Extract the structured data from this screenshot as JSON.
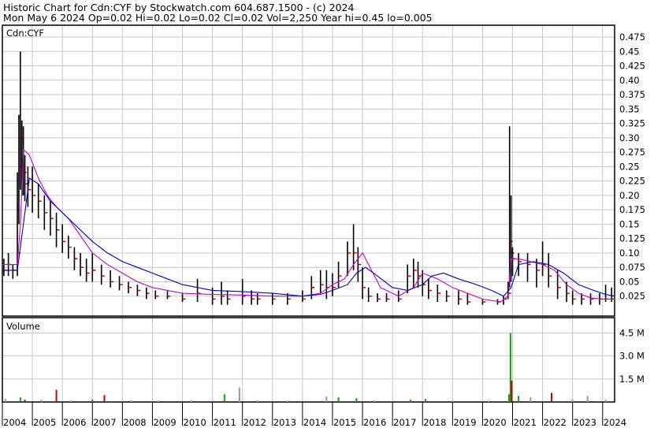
{
  "header": {
    "line1": "Historic Chart for Cdn:CYF  by Stockwatch.com 604.687.1500 - (c) 2024",
    "line2": "Mon May  6 2024   Op=0.02  Hi=0.02  Lo=0.02  Cl=0.02  Vol=2,250  Year hi=0.45  lo=0.005"
  },
  "price_panel": {
    "label": "Cdn:CYF"
  },
  "volume_panel": {
    "label": "Volume"
  },
  "colors": {
    "grid": "#c8c8c8",
    "bar": "#000000",
    "close_tick": "#cc0000",
    "ma_short": "#cc00cc",
    "ma_long": "#0000cc",
    "vol_up": "#00aa00",
    "vol_down": "#cc0000",
    "vol_flat": "#999999"
  },
  "chart_data": [
    {
      "type": "line",
      "title": "",
      "ylim": [
        0,
        0.475
      ],
      "y_ticks": [
        0.025,
        0.05,
        0.075,
        0.1,
        0.125,
        0.15,
        0.175,
        0.2,
        0.225,
        0.25,
        0.275,
        0.3,
        0.325,
        0.35,
        0.375,
        0.4,
        0.425,
        0.45,
        0.475
      ],
      "y_tick_labels": [
        "0.025",
        "0.05",
        "0.075",
        "0.10",
        "0.125",
        "0.15",
        "0.175",
        "0.20",
        "0.225",
        "0.25",
        "0.275",
        "0.30",
        "0.325",
        "0.35",
        "0.375",
        "0.40",
        "0.425",
        "0.45",
        "0.475"
      ],
      "x_tick_labels": [
        "2004",
        "2005",
        "2006",
        "2007",
        "2008",
        "2009",
        "2010",
        "2011",
        "2012",
        "2013",
        "2014",
        "2015",
        "2016",
        "2017",
        "2018",
        "2019",
        "2020",
        "2021",
        "2022",
        "2023",
        "2024"
      ],
      "x_range": [
        2004.0,
        2024.4
      ],
      "series": [
        {
          "style": "high-low-bars",
          "x": [
            2004.05,
            2004.2,
            2004.35,
            2004.5,
            2004.55,
            2004.6,
            2004.65,
            2004.7,
            2004.75,
            2004.85,
            2005.0,
            2005.2,
            2005.4,
            2005.6,
            2005.8,
            2006.0,
            2006.2,
            2006.4,
            2006.6,
            2006.8,
            2007.0,
            2007.3,
            2007.6,
            2007.9,
            2008.2,
            2008.5,
            2008.8,
            2009.1,
            2009.5,
            2010.0,
            2010.5,
            2011.0,
            2011.3,
            2011.5,
            2012.0,
            2012.3,
            2012.5,
            2013.0,
            2013.5,
            2014.0,
            2014.3,
            2014.6,
            2014.8,
            2015.0,
            2015.2,
            2015.5,
            2015.7,
            2015.85,
            2016.0,
            2016.2,
            2016.5,
            2016.8,
            2017.2,
            2017.5,
            2017.7,
            2017.85,
            2018.0,
            2018.2,
            2018.5,
            2018.8,
            2019.2,
            2019.5,
            2020.0,
            2020.5,
            2020.7,
            2020.85,
            2020.9,
            2020.95,
            2021.0,
            2021.2,
            2021.5,
            2021.8,
            2022.0,
            2022.2,
            2022.5,
            2022.8,
            2023.0,
            2023.3,
            2023.6,
            2023.9,
            2024.1,
            2024.3
          ],
          "high": [
            0.09,
            0.1,
            0.08,
            0.24,
            0.34,
            0.45,
            0.33,
            0.32,
            0.27,
            0.25,
            0.25,
            0.22,
            0.2,
            0.19,
            0.17,
            0.15,
            0.13,
            0.11,
            0.1,
            0.09,
            0.1,
            0.08,
            0.07,
            0.06,
            0.05,
            0.045,
            0.04,
            0.035,
            0.035,
            0.03,
            0.055,
            0.04,
            0.05,
            0.035,
            0.055,
            0.035,
            0.03,
            0.03,
            0.03,
            0.035,
            0.06,
            0.07,
            0.07,
            0.065,
            0.085,
            0.12,
            0.15,
            0.11,
            0.075,
            0.04,
            0.03,
            0.03,
            0.035,
            0.08,
            0.09,
            0.085,
            0.07,
            0.055,
            0.045,
            0.035,
            0.035,
            0.03,
            0.02,
            0.02,
            0.025,
            0.05,
            0.32,
            0.2,
            0.11,
            0.1,
            0.1,
            0.09,
            0.12,
            0.1,
            0.07,
            0.05,
            0.035,
            0.03,
            0.03,
            0.03,
            0.045,
            0.04
          ],
          "low": [
            0.06,
            0.06,
            0.055,
            0.06,
            0.15,
            0.21,
            0.2,
            0.2,
            0.19,
            0.18,
            0.17,
            0.16,
            0.14,
            0.13,
            0.11,
            0.1,
            0.09,
            0.07,
            0.06,
            0.05,
            0.05,
            0.045,
            0.04,
            0.035,
            0.03,
            0.025,
            0.02,
            0.02,
            0.02,
            0.015,
            0.015,
            0.01,
            0.01,
            0.01,
            0.01,
            0.01,
            0.01,
            0.01,
            0.01,
            0.015,
            0.02,
            0.03,
            0.02,
            0.025,
            0.04,
            0.06,
            0.07,
            0.05,
            0.02,
            0.015,
            0.015,
            0.015,
            0.015,
            0.03,
            0.04,
            0.04,
            0.025,
            0.02,
            0.015,
            0.015,
            0.01,
            0.01,
            0.01,
            0.01,
            0.01,
            0.02,
            0.04,
            0.05,
            0.06,
            0.06,
            0.05,
            0.04,
            0.06,
            0.04,
            0.02,
            0.015,
            0.01,
            0.01,
            0.01,
            0.01,
            0.015,
            0.015
          ],
          "close": [
            0.07,
            0.08,
            0.07,
            0.1,
            0.25,
            0.3,
            0.25,
            0.24,
            0.22,
            0.21,
            0.2,
            0.19,
            0.17,
            0.16,
            0.14,
            0.12,
            0.11,
            0.09,
            0.075,
            0.065,
            0.07,
            0.06,
            0.05,
            0.045,
            0.04,
            0.035,
            0.03,
            0.025,
            0.025,
            0.02,
            0.03,
            0.02,
            0.025,
            0.02,
            0.025,
            0.02,
            0.02,
            0.02,
            0.02,
            0.02,
            0.04,
            0.045,
            0.04,
            0.04,
            0.06,
            0.1,
            0.1,
            0.08,
            0.04,
            0.025,
            0.02,
            0.02,
            0.02,
            0.06,
            0.07,
            0.06,
            0.045,
            0.035,
            0.03,
            0.025,
            0.02,
            0.015,
            0.015,
            0.015,
            0.02,
            0.03,
            0.12,
            0.1,
            0.09,
            0.085,
            0.08,
            0.07,
            0.08,
            0.06,
            0.04,
            0.03,
            0.02,
            0.02,
            0.02,
            0.02,
            0.02,
            0.02
          ]
        },
        {
          "name": "",
          "style": "moving-average",
          "color_key": "ma_short",
          "x": [
            2004.0,
            2004.5,
            2004.6,
            2004.7,
            2004.9,
            2005.2,
            2005.5,
            2005.8,
            2006.2,
            2006.6,
            2007.0,
            2007.5,
            2008.0,
            2008.5,
            2009.0,
            2010.0,
            2011.0,
            2012.0,
            2013.0,
            2014.0,
            2014.6,
            2015.0,
            2015.4,
            2015.7,
            2016.0,
            2016.3,
            2016.6,
            2017.2,
            2017.7,
            2018.0,
            2018.5,
            2019.0,
            2019.5,
            2020.0,
            2020.6,
            2020.85,
            2020.95,
            2021.2,
            2021.6,
            2022.0,
            2022.4,
            2022.8,
            2023.2,
            2023.6,
            2024.0,
            2024.4
          ],
          "y": [
            0.08,
            0.08,
            0.15,
            0.28,
            0.27,
            0.23,
            0.2,
            0.18,
            0.16,
            0.13,
            0.1,
            0.08,
            0.065,
            0.05,
            0.04,
            0.03,
            0.028,
            0.027,
            0.025,
            0.025,
            0.03,
            0.045,
            0.055,
            0.08,
            0.1,
            0.07,
            0.04,
            0.025,
            0.04,
            0.065,
            0.055,
            0.04,
            0.03,
            0.02,
            0.015,
            0.025,
            0.09,
            0.09,
            0.085,
            0.08,
            0.07,
            0.045,
            0.03,
            0.022,
            0.02,
            0.02
          ]
        },
        {
          "name": "",
          "style": "moving-average",
          "color_key": "ma_long",
          "x": [
            2004.0,
            2004.5,
            2004.7,
            2004.9,
            2005.2,
            2005.6,
            2006.0,
            2006.5,
            2007.0,
            2007.5,
            2008.0,
            2008.5,
            2009.0,
            2009.5,
            2010.0,
            2011.0,
            2012.0,
            2013.0,
            2014.0,
            2014.6,
            2015.0,
            2015.5,
            2015.8,
            2016.1,
            2016.5,
            2017.0,
            2017.5,
            2018.0,
            2018.3,
            2018.7,
            2019.2,
            2019.8,
            2020.3,
            2020.7,
            2020.95,
            2021.2,
            2021.7,
            2022.2,
            2022.7,
            2023.2,
            2023.7,
            2024.1,
            2024.4
          ],
          "y": [
            0.07,
            0.07,
            0.15,
            0.23,
            0.22,
            0.19,
            0.17,
            0.145,
            0.12,
            0.1,
            0.085,
            0.075,
            0.065,
            0.055,
            0.045,
            0.035,
            0.033,
            0.03,
            0.025,
            0.028,
            0.035,
            0.045,
            0.065,
            0.075,
            0.06,
            0.04,
            0.035,
            0.045,
            0.06,
            0.065,
            0.055,
            0.045,
            0.035,
            0.025,
            0.04,
            0.08,
            0.085,
            0.08,
            0.065,
            0.045,
            0.035,
            0.028,
            0.025
          ]
        }
      ]
    },
    {
      "type": "bar",
      "title": "",
      "y_unit": "M",
      "ylim": [
        0,
        5.5
      ],
      "y_ticks": [
        1.5,
        3.0,
        4.5
      ],
      "y_tick_labels": [
        "1.5 M",
        "3.0 M",
        "4.5 M"
      ],
      "x_tick_labels": [
        "2004",
        "2005",
        "2006",
        "2007",
        "2008",
        "2009",
        "2010",
        "2011",
        "2012",
        "2013",
        "2014",
        "2015",
        "2016",
        "2017",
        "2018",
        "2019",
        "2020",
        "2021",
        "2022",
        "2023",
        "2024"
      ],
      "bars": [
        {
          "x": 2004.1,
          "v": 0.2,
          "dir": "flat"
        },
        {
          "x": 2004.6,
          "v": 0.3,
          "dir": "up"
        },
        {
          "x": 2004.75,
          "v": 0.15,
          "dir": "down"
        },
        {
          "x": 2005.3,
          "v": 0.15,
          "dir": "flat"
        },
        {
          "x": 2005.8,
          "v": 0.8,
          "dir": "down"
        },
        {
          "x": 2006.3,
          "v": 0.1,
          "dir": "flat"
        },
        {
          "x": 2007.0,
          "v": 0.15,
          "dir": "up"
        },
        {
          "x": 2007.4,
          "v": 0.45,
          "dir": "down"
        },
        {
          "x": 2008.3,
          "v": 0.1,
          "dir": "flat"
        },
        {
          "x": 2009.2,
          "v": 0.08,
          "dir": "flat"
        },
        {
          "x": 2010.3,
          "v": 0.1,
          "dir": "flat"
        },
        {
          "x": 2011.4,
          "v": 0.5,
          "dir": "up"
        },
        {
          "x": 2011.9,
          "v": 0.95,
          "dir": "flat"
        },
        {
          "x": 2012.5,
          "v": 0.1,
          "dir": "flat"
        },
        {
          "x": 2013.5,
          "v": 0.08,
          "dir": "flat"
        },
        {
          "x": 2014.8,
          "v": 0.35,
          "dir": "flat"
        },
        {
          "x": 2015.2,
          "v": 0.3,
          "dir": "up"
        },
        {
          "x": 2015.8,
          "v": 0.25,
          "dir": "up"
        },
        {
          "x": 2016.4,
          "v": 0.1,
          "dir": "flat"
        },
        {
          "x": 2017.6,
          "v": 0.15,
          "dir": "up"
        },
        {
          "x": 2018.1,
          "v": 0.2,
          "dir": "up"
        },
        {
          "x": 2019.0,
          "v": 0.08,
          "dir": "flat"
        },
        {
          "x": 2020.2,
          "v": 0.08,
          "dir": "flat"
        },
        {
          "x": 2020.88,
          "v": 0.5,
          "dir": "up"
        },
        {
          "x": 2020.93,
          "v": 4.5,
          "dir": "up"
        },
        {
          "x": 2020.97,
          "v": 1.4,
          "dir": "down"
        },
        {
          "x": 2021.2,
          "v": 0.4,
          "dir": "up"
        },
        {
          "x": 2021.6,
          "v": 0.3,
          "dir": "flat"
        },
        {
          "x": 2022.3,
          "v": 0.6,
          "dir": "down"
        },
        {
          "x": 2023.0,
          "v": 0.15,
          "dir": "flat"
        },
        {
          "x": 2023.5,
          "v": 0.4,
          "dir": "flat"
        },
        {
          "x": 2024.1,
          "v": 0.15,
          "dir": "flat"
        }
      ]
    }
  ]
}
